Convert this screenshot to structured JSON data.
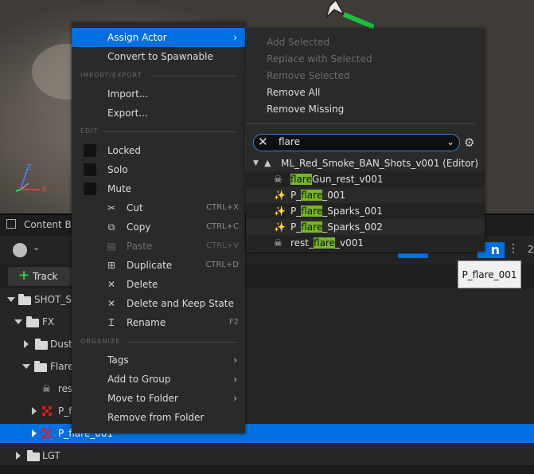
{
  "viewport": {
    "axes": {
      "x": "X",
      "z": "Z"
    }
  },
  "content_browser": {
    "tab_label": "Content Br",
    "add_track_label": "Track",
    "right_number": "2"
  },
  "outliner": {
    "rows": [
      {
        "label": "SHOT_SE"
      },
      {
        "label": "FX"
      },
      {
        "label": "Dust"
      },
      {
        "label": "Flare"
      },
      {
        "label": "res"
      },
      {
        "label": "P_f"
      },
      {
        "label": "P_flare_001"
      },
      {
        "label": "LGT"
      }
    ]
  },
  "context_menu": {
    "assign_actor": "Assign Actor",
    "convert": "Convert to Spawnable",
    "section_import_export": "IMPORT/EXPORT",
    "import": "Import...",
    "export": "Export...",
    "section_edit": "EDIT",
    "locked": "Locked",
    "solo": "Solo",
    "mute": "Mute",
    "cut": "Cut",
    "cut_sc": "CTRL+X",
    "copy": "Copy",
    "copy_sc": "CTRL+C",
    "paste": "Paste",
    "paste_sc": "CTRL+V",
    "duplicate": "Duplicate",
    "duplicate_sc": "CTRL+D",
    "delete": "Delete",
    "delete_keep": "Delete and Keep State",
    "rename": "Rename",
    "rename_sc": "F2",
    "section_organize": "ORGANIZE",
    "tags": "Tags",
    "add_group": "Add to Group",
    "move_folder": "Move to Folder",
    "remove_folder": "Remove from Folder"
  },
  "submenu": {
    "add_selected": "Add Selected",
    "replace_selected": "Replace with Selected",
    "remove_selected": "Remove Selected",
    "remove_all": "Remove All",
    "remove_missing": "Remove Missing",
    "search_value": "flare",
    "level_label": "ML_Red_Smoke_BAN_Shots_v001 (Editor)",
    "results": [
      {
        "pre": "",
        "match": "flare",
        "post": "Gun_rest_v001",
        "icon": "skeleton-icon"
      },
      {
        "pre": "P_",
        "match": "flare",
        "post": "_001",
        "icon": "sparkle-icon"
      },
      {
        "pre": "P_",
        "match": "flare",
        "post": "_Sparks_001",
        "icon": "sparkle-icon"
      },
      {
        "pre": "P_",
        "match": "flare",
        "post": "_Sparks_002",
        "icon": "sparkle-icon"
      },
      {
        "pre": "rest_",
        "match": "flare",
        "post": "_v001",
        "icon": "skeleton-icon"
      }
    ]
  },
  "tooltip": {
    "text": "P_flare_001"
  },
  "colors": {
    "accent": "#0070e0",
    "highlight": "#76b82a"
  }
}
